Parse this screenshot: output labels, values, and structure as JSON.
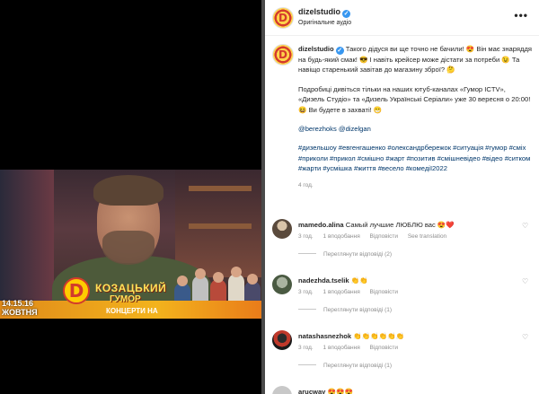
{
  "post": {
    "username": "dizelstudio",
    "subtitle": "Оригінальне аудіо",
    "more_label": "•••",
    "avatar_letter": "D"
  },
  "video": {
    "date_top": "14.15.16",
    "date_bottom": "ЖОВТНЯ",
    "logo_letter": "D",
    "title_line1": "КОЗАЦЬКИЙ",
    "title_line2": "ГУМОР",
    "title_line3": "КОНЦЕРТИ НА"
  },
  "caption": {
    "username": "dizelstudio",
    "paragraph1": "Такого дідуся ви ще точно не бачили! 😍 Він має знаряддя на будь-який смак! 😎 І навіть крейсер може дістати за потреби 😉 Та навіщо старенький завітав до магазину зброї? 🤔",
    "paragraph2": "Подробиці дивіться тільки на наших ютуб-каналах «Гумор ICTV», «Дизель Студіо» та «Дизель Українські Серіали» уже 30 вересня о 20:00! 😆 Ви будете в захваті! 😁",
    "mentions": "@berezhoks @dizelgan",
    "hashtags": "#дизельшоу #евгенгашенко #олександрбережок #ситуація #гумор #сміх #приколи #прикол #смішно #жарт #позитив #смішневідео #відео #ситком #жарти #усмішка #життя #весело #комедії2022",
    "time": "4 год."
  },
  "comments": [
    {
      "username": "mamedo.alina",
      "text": "Самый лучшие ЛЮБЛЮ вас 😍❤️",
      "time": "3 год.",
      "likes": "1 вподобання",
      "reply": "Відповісти",
      "translate": "See translation",
      "view_replies": "Переглянути відповіді (2)"
    },
    {
      "username": "nadezhda.tselik",
      "text": "👏👏",
      "time": "3 год.",
      "likes": "1 вподобання",
      "reply": "Відповісти",
      "view_replies": "Переглянути відповіді (1)"
    },
    {
      "username": "natashasnezhok",
      "text": "👏👏👏👏👏👏",
      "time": "3 год.",
      "likes": "1 вподобання",
      "reply": "Відповісти",
      "view_replies": "Переглянути відповіді (1)"
    },
    {
      "username": "arucway",
      "text": "😍😍😍"
    }
  ],
  "colors": {
    "link": "#00376b",
    "verified": "#3897f0",
    "meta": "#8e8e8e"
  }
}
